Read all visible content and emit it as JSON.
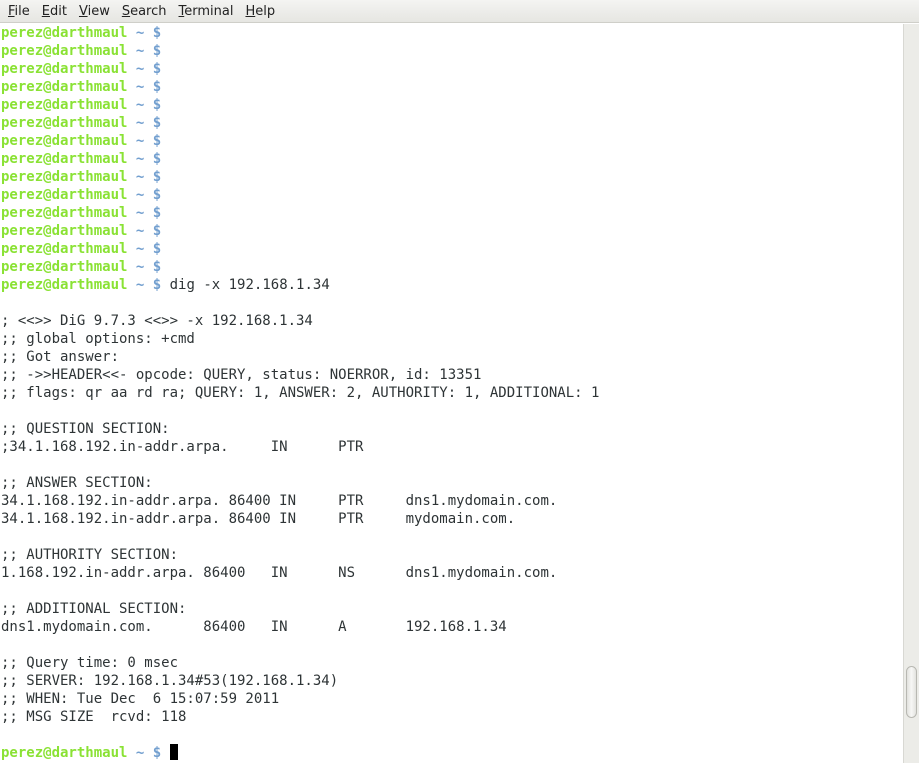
{
  "menubar": {
    "items": [
      {
        "mnemonic": "F",
        "rest": "ile"
      },
      {
        "mnemonic": "E",
        "rest": "dit"
      },
      {
        "mnemonic": "V",
        "rest": "iew"
      },
      {
        "mnemonic": "S",
        "rest": "earch"
      },
      {
        "mnemonic": "T",
        "rest": "erminal"
      },
      {
        "mnemonic": "H",
        "rest": "elp"
      }
    ]
  },
  "prompt": {
    "user_host": "perez@darthmaul",
    "path": "~",
    "symbol": "$"
  },
  "terminal": {
    "lines": [
      {
        "type": "prompt",
        "cmd": ""
      },
      {
        "type": "prompt",
        "cmd": ""
      },
      {
        "type": "prompt",
        "cmd": ""
      },
      {
        "type": "prompt",
        "cmd": ""
      },
      {
        "type": "prompt",
        "cmd": ""
      },
      {
        "type": "prompt",
        "cmd": ""
      },
      {
        "type": "prompt",
        "cmd": ""
      },
      {
        "type": "prompt",
        "cmd": ""
      },
      {
        "type": "prompt",
        "cmd": ""
      },
      {
        "type": "prompt",
        "cmd": ""
      },
      {
        "type": "prompt",
        "cmd": ""
      },
      {
        "type": "prompt",
        "cmd": ""
      },
      {
        "type": "prompt",
        "cmd": ""
      },
      {
        "type": "prompt",
        "cmd": ""
      },
      {
        "type": "prompt",
        "cmd": "dig -x 192.168.1.34"
      },
      {
        "type": "text",
        "text": ""
      },
      {
        "type": "text",
        "text": "; <<>> DiG 9.7.3 <<>> -x 192.168.1.34"
      },
      {
        "type": "text",
        "text": ";; global options: +cmd"
      },
      {
        "type": "text",
        "text": ";; Got answer:"
      },
      {
        "type": "text",
        "text": ";; ->>HEADER<<- opcode: QUERY, status: NOERROR, id: 13351"
      },
      {
        "type": "text",
        "text": ";; flags: qr aa rd ra; QUERY: 1, ANSWER: 2, AUTHORITY: 1, ADDITIONAL: 1"
      },
      {
        "type": "text",
        "text": ""
      },
      {
        "type": "text",
        "text": ";; QUESTION SECTION:"
      },
      {
        "type": "text",
        "text": ";34.1.168.192.in-addr.arpa.     IN      PTR"
      },
      {
        "type": "text",
        "text": ""
      },
      {
        "type": "text",
        "text": ";; ANSWER SECTION:"
      },
      {
        "type": "text",
        "text": "34.1.168.192.in-addr.arpa. 86400 IN     PTR     dns1.mydomain.com."
      },
      {
        "type": "text",
        "text": "34.1.168.192.in-addr.arpa. 86400 IN     PTR     mydomain.com."
      },
      {
        "type": "text",
        "text": ""
      },
      {
        "type": "text",
        "text": ";; AUTHORITY SECTION:"
      },
      {
        "type": "text",
        "text": "1.168.192.in-addr.arpa. 86400   IN      NS      dns1.mydomain.com."
      },
      {
        "type": "text",
        "text": ""
      },
      {
        "type": "text",
        "text": ";; ADDITIONAL SECTION:"
      },
      {
        "type": "text",
        "text": "dns1.mydomain.com.      86400   IN      A       192.168.1.34"
      },
      {
        "type": "text",
        "text": ""
      },
      {
        "type": "text",
        "text": ";; Query time: 0 msec"
      },
      {
        "type": "text",
        "text": ";; SERVER: 192.168.1.34#53(192.168.1.34)"
      },
      {
        "type": "text",
        "text": ";; WHEN: Tue Dec  6 15:07:59 2011"
      },
      {
        "type": "text",
        "text": ";; MSG SIZE  rcvd: 118"
      },
      {
        "type": "text",
        "text": ""
      },
      {
        "type": "prompt",
        "cmd": "",
        "cursor": true
      }
    ]
  },
  "colors": {
    "prompt_user": "#8ae234",
    "prompt_path": "#729fcf",
    "text": "#2e3436",
    "background": "#ffffff"
  }
}
